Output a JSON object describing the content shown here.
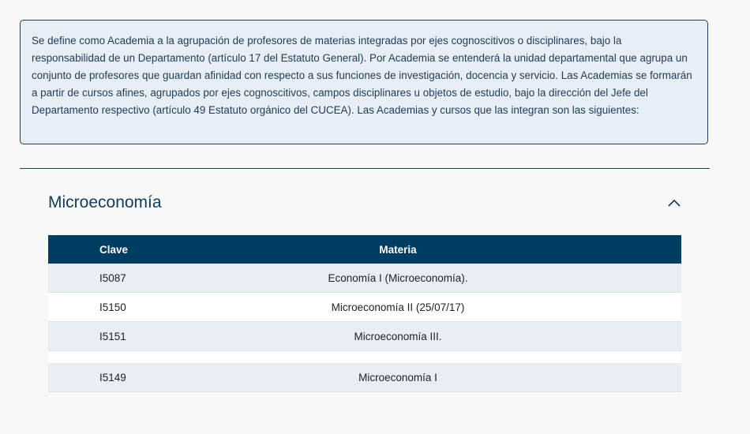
{
  "intro": {
    "text": "Se define como Academia a la agrupación de profesores de materias integradas por ejes cognoscitivos o disciplinares, bajo la responsabilidad de un Departamento (artículo 17 del Estatuto General). Por Academia se entenderá la unidad departamental que agrupa un conjunto de profesores que guardan afinidad con respecto a sus funciones de investigación, docencia y servicio. Las Academias se formarán a partir de cursos afines, agrupados por ejes cognoscitivos, campos disciplinares u objetos de estudio, bajo la dirección del Jefe del Departamento respectivo (artículo 49 Estatuto orgánico del CUCEA). Las Academias y cursos que las integran son las siguientes:"
  },
  "section": {
    "title": "Microeconomía",
    "toggle_icon": "chevron-up-icon"
  },
  "table": {
    "headers": {
      "clave": "Clave",
      "materia": "Materia"
    },
    "rows": [
      {
        "clave": "I5087",
        "materia": "Economía I (Microeconomía)."
      },
      {
        "clave": "I5150",
        "materia": "Microeconomía II (25/07/17)"
      },
      {
        "clave": "I5151",
        "materia": "Microeconomía III."
      },
      {
        "clave": "I5149",
        "materia": "Microeconomía I"
      }
    ]
  },
  "colors": {
    "header_bg": "#003d63",
    "accent": "#1c3d66",
    "info_bg": "#e8eef5",
    "row_shade": "#e9eef4"
  }
}
